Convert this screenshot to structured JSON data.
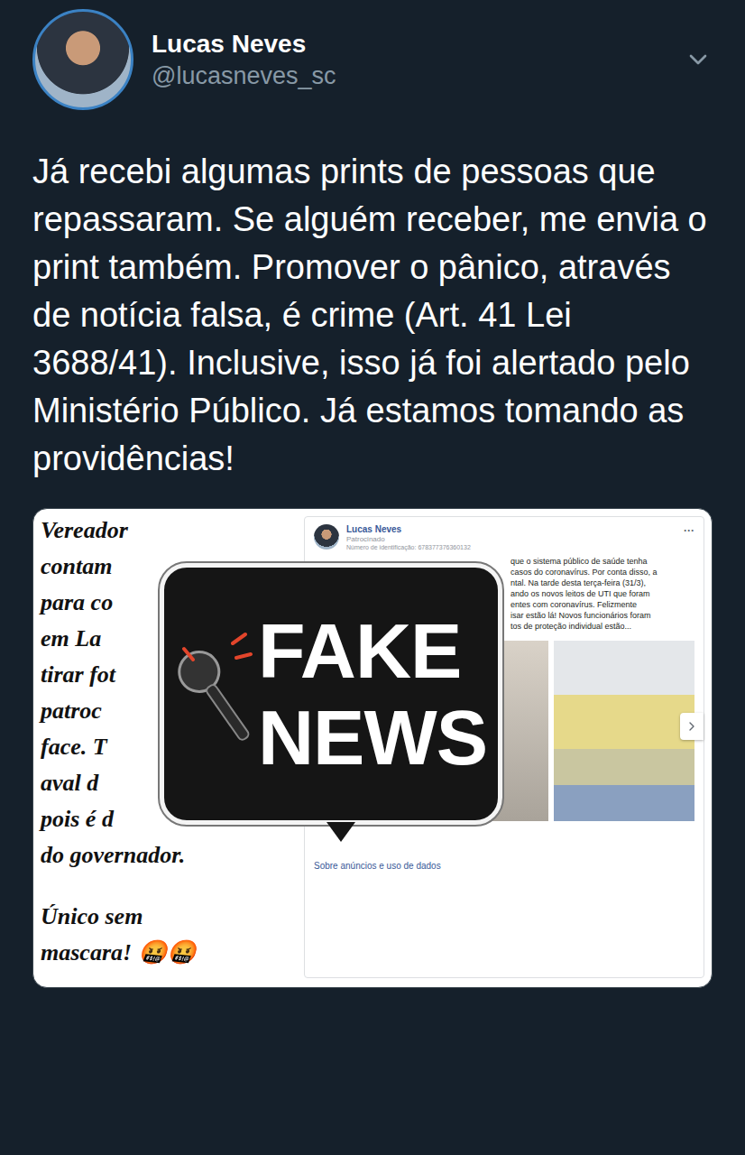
{
  "author": {
    "name": "Lucas Neves",
    "handle": "@lucasneves_sc"
  },
  "tweet": {
    "text": "Já recebi algumas prints de pessoas que repassaram. Se alguém receber, me envia o print também. Promover o pânico, através de notícia falsa, é crime (Art. 41 Lei 3688/41). Inclusive, isso já foi alertado pelo Ministério Público. Já estamos tomando as providências!"
  },
  "media": {
    "caption_lines": [
      "Vereador",
      "contam",
      "para co",
      "em La",
      "tirar fot",
      "patroc",
      "face. T",
      "aval d",
      "pois é d",
      "do governador."
    ],
    "caption_tail": [
      "Único sem",
      "mascara! 🤬🤬"
    ],
    "stamp": [
      "FAKE",
      "NEWS"
    ],
    "ad": {
      "name": "Lucas Neves",
      "label": "Patrocinado",
      "id": "Número de identificação: 678377376360132",
      "menu": "···",
      "body": [
        "que o sistema público de saúde tenha",
        "casos do coronavírus. Por conta disso, a",
        "ntal. Na tarde desta terça-feira (31/3),",
        "ando os novos leitos de UTI que foram",
        "entes com coronavírus. Felizmente",
        "isar estão lá! Novos funcionários foram",
        "tos de proteção individual estão..."
      ],
      "footer": "Sobre anúncios e uso de dados"
    }
  }
}
